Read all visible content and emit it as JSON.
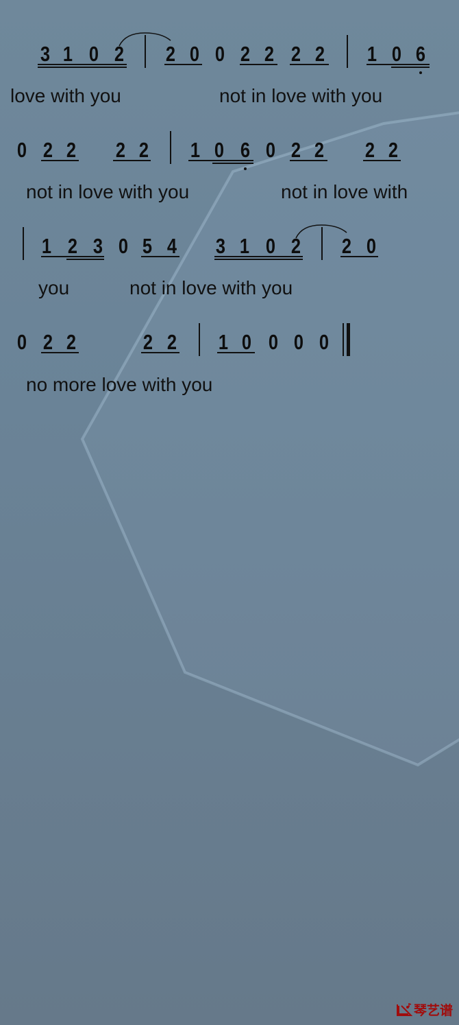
{
  "score": {
    "rows": [
      {
        "notes": [
          "3",
          "1",
          "0",
          "2",
          "2",
          "0",
          "0",
          "2",
          "2",
          "2",
          "2",
          "1",
          "0",
          "6"
        ],
        "lyrics": [
          "love with you",
          "not in love with you"
        ]
      },
      {
        "notes": [
          "0",
          "2",
          "2",
          "2",
          "2",
          "1",
          "0",
          "6",
          "0",
          "2",
          "2",
          "2",
          "2"
        ],
        "lyrics": [
          "not in love with you",
          "not in love with"
        ]
      },
      {
        "notes": [
          "1",
          "2",
          "3",
          "0",
          "5",
          "4",
          "3",
          "1",
          "0",
          "2",
          "2",
          "0"
        ],
        "lyrics": [
          "you",
          "not in love with you"
        ]
      },
      {
        "notes": [
          "0",
          "2",
          "2",
          "2",
          "2",
          "1",
          "0",
          "0",
          "0",
          "0"
        ],
        "lyrics": [
          "no more love with you"
        ]
      }
    ]
  },
  "watermark": {
    "text": "琴艺谱",
    "icon": "piano-note-logo-icon",
    "color": "#a00d0d"
  },
  "colors": {
    "background": "#6a8397",
    "ink": "#111111"
  }
}
